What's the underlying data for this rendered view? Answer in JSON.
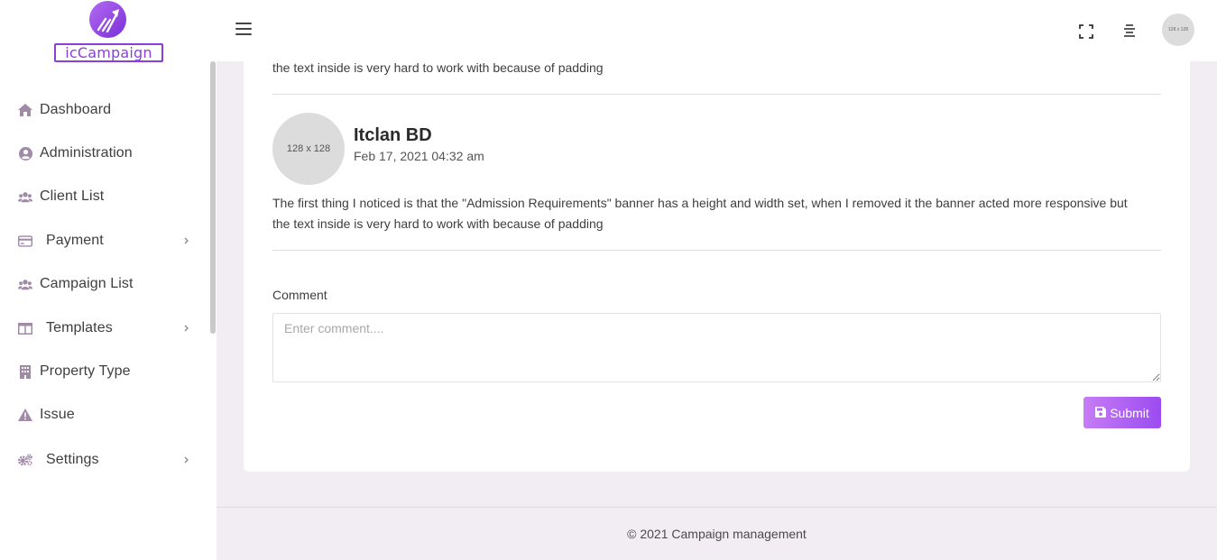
{
  "app": {
    "logo_text": "icCampaign",
    "brand_color": "#8b3fd9"
  },
  "sidebar": {
    "items": [
      {
        "label": "Dashboard",
        "icon": "home-icon",
        "has_submenu": false
      },
      {
        "label": "Administration",
        "icon": "user-circle-icon",
        "has_submenu": false
      },
      {
        "label": "Client List",
        "icon": "users-icon",
        "has_submenu": false
      },
      {
        "label": "Payment",
        "icon": "credit-card-icon",
        "has_submenu": true
      },
      {
        "label": "Campaign List",
        "icon": "users-icon",
        "has_submenu": false
      },
      {
        "label": "Templates",
        "icon": "columns-icon",
        "has_submenu": true
      },
      {
        "label": "Property Type",
        "icon": "building-icon",
        "has_submenu": false
      },
      {
        "label": "Issue",
        "icon": "warning-icon",
        "has_submenu": false
      },
      {
        "label": "Settings",
        "icon": "cogs-icon",
        "has_submenu": true
      }
    ],
    "icon_color": "#a08aa8"
  },
  "header": {
    "avatar_text": "128 x 128"
  },
  "comments": [
    {
      "text_tail": "the text inside is very hard to work with because of padding"
    },
    {
      "author": "Itclan BD",
      "date": "Feb 17, 2021 04:32 am",
      "avatar_text": "128 x 128",
      "text_line1": "The first thing I noticed is that the \"Admission Requirements\" banner has a height and width set, when I removed it the banner acted more responsive but",
      "text_line2": "the text inside is very hard to work with because of padding"
    }
  ],
  "comment_form": {
    "label": "Comment",
    "placeholder": "Enter comment....",
    "value": "",
    "submit_label": "Submit"
  },
  "footer": {
    "text": "© 2021 Campaign management"
  }
}
